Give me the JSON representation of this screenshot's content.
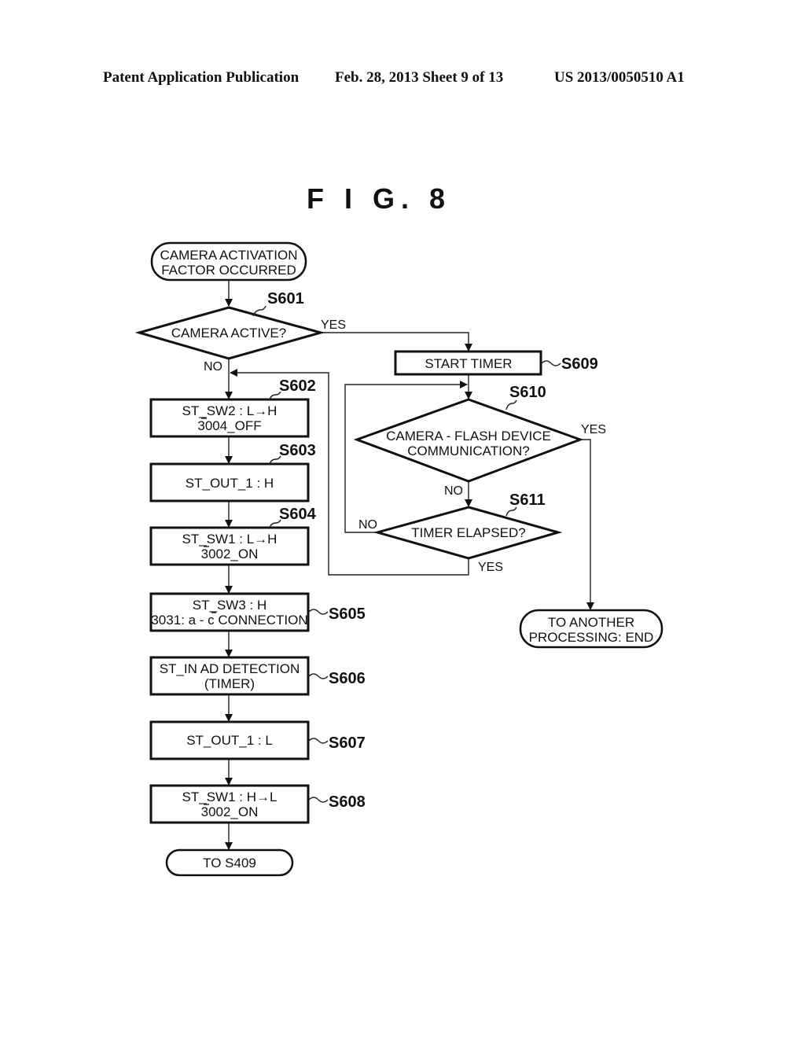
{
  "header": {
    "left": "Patent Application Publication",
    "middle": "Feb. 28, 2013   Sheet 9 of 13",
    "right": "US 2013/0050510 A1"
  },
  "figure": {
    "title": "F I G. 8"
  },
  "flowchart": {
    "start": {
      "lines": [
        "CAMERA ACTIVATION",
        "FACTOR OCCURRED"
      ]
    },
    "s601": {
      "step": "S601",
      "lines": [
        "CAMERA ACTIVE?"
      ],
      "yes": "YES",
      "no": "NO"
    },
    "s602": {
      "step": "S602",
      "lines": [
        "ST_SW2 : L→H",
        "3004_OFF"
      ]
    },
    "s603": {
      "step": "S603",
      "lines": [
        "ST_OUT_1 : H"
      ]
    },
    "s604": {
      "step": "S604",
      "lines": [
        "ST_SW1 : L→H",
        "3002_ON"
      ]
    },
    "s605": {
      "step": "S605",
      "lines": [
        "ST_SW3 : H",
        "3031: a - c CONNECTION"
      ]
    },
    "s606": {
      "step": "S606",
      "lines": [
        "ST_IN AD DETECTION",
        "(TIMER)"
      ]
    },
    "s607": {
      "step": "S607",
      "lines": [
        "ST_OUT_1 : L"
      ]
    },
    "s608": {
      "step": "S608",
      "lines": [
        "ST_SW1 : H→L",
        "3002_ON"
      ]
    },
    "end_left": {
      "lines": [
        "TO S409"
      ]
    },
    "s609": {
      "step": "S609",
      "lines": [
        "START TIMER"
      ]
    },
    "s610": {
      "step": "S610",
      "lines": [
        "CAMERA - FLASH DEVICE",
        "COMMUNICATION?"
      ],
      "yes": "YES",
      "no": "NO"
    },
    "s611": {
      "step": "S611",
      "lines": [
        "TIMER ELAPSED?"
      ],
      "yes": "YES",
      "no": "NO"
    },
    "end_right": {
      "lines": [
        "TO ANOTHER",
        "PROCESSING: END"
      ]
    }
  }
}
